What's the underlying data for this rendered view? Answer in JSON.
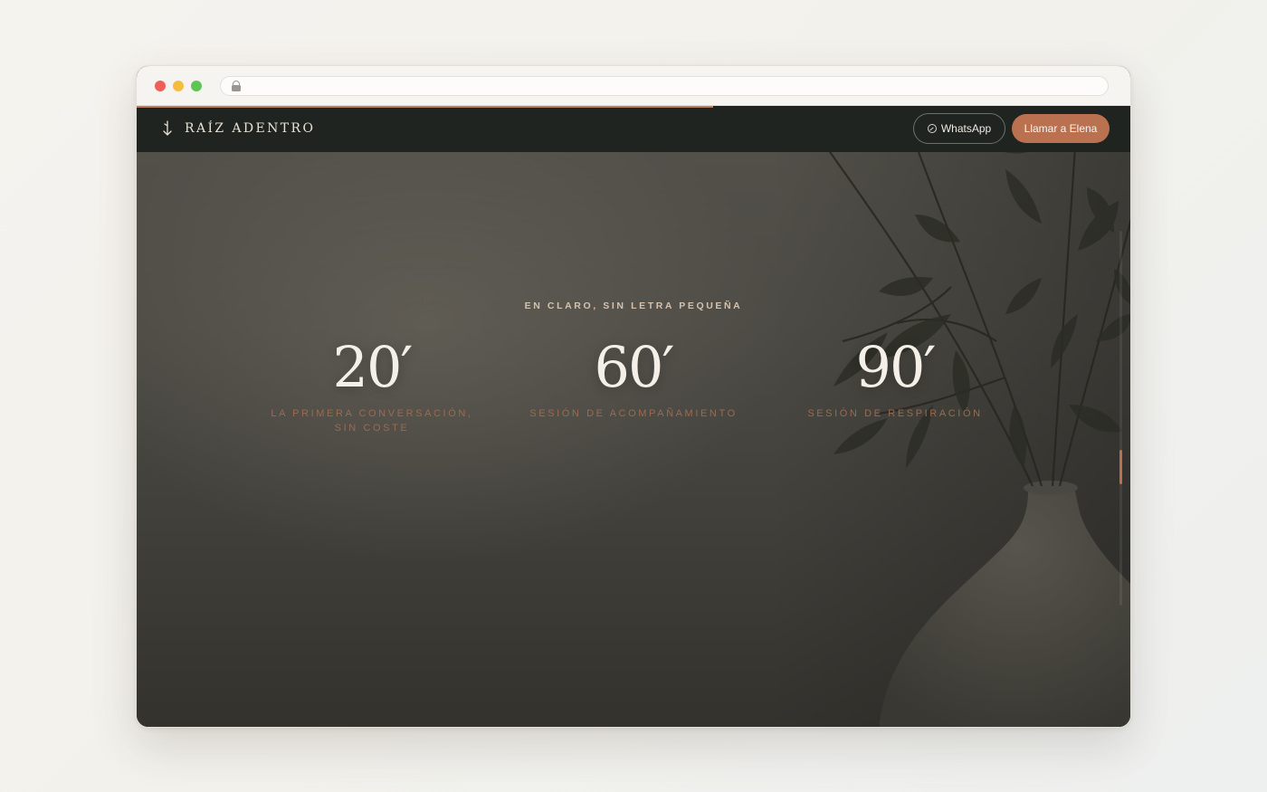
{
  "browser": {
    "url": "",
    "icons": {
      "lock": "lock-icon"
    }
  },
  "site": {
    "brand_name": "RAÍZ ADENTRO",
    "brand_icon": "root-arrow-icon",
    "whatsapp_label": "WhatsApp",
    "whatsapp_icon": "whatsapp-icon",
    "call_label": "Llamar a Elena",
    "scroll_progress": 0.58
  },
  "hero": {
    "eyebrow": "EN CLARO, SIN LETRA PEQUEÑA",
    "stats": [
      {
        "value": "20′",
        "label": "LA PRIMERA CONVERSACIÓN, SIN COSTE"
      },
      {
        "value": "60′",
        "label": "SESIÓN DE ACOMPAÑAMIENTO"
      },
      {
        "value": "90′",
        "label": "SESIÓN DE RESPIRACIÓN"
      }
    ]
  },
  "colors": {
    "accent": "#b9714f",
    "nav_bg": "#1f2421",
    "label": "#9a6b52",
    "eyebrow": "#d4c2ad"
  }
}
